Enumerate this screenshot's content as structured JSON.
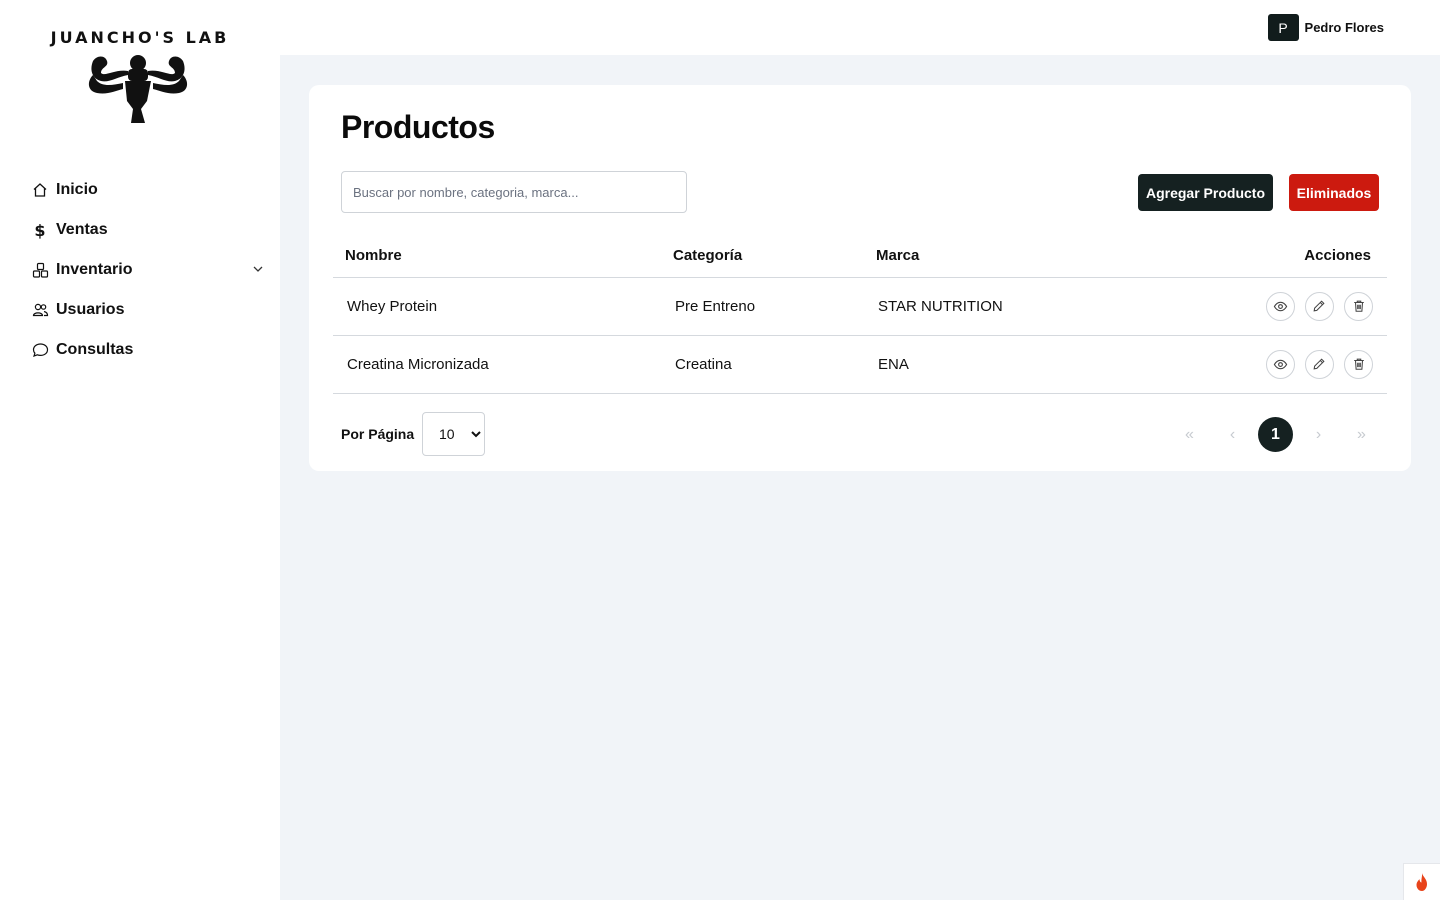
{
  "brand": {
    "name": "JUANCHO'S LAB"
  },
  "sidebar": {
    "items": [
      {
        "label": "Inicio",
        "icon": "home-icon"
      },
      {
        "label": "Ventas",
        "icon": "dollar-icon"
      },
      {
        "label": "Inventario",
        "icon": "boxes-icon",
        "expandable": true
      },
      {
        "label": "Usuarios",
        "icon": "users-icon"
      },
      {
        "label": "Consultas",
        "icon": "chat-icon"
      }
    ]
  },
  "header": {
    "avatar_initial": "P",
    "user_name": "Pedro Flores"
  },
  "main": {
    "title": "Productos",
    "search_placeholder": "Buscar por nombre, categoria, marca...",
    "add_button": "Agregar Producto",
    "deleted_button": "Eliminados",
    "table": {
      "headers": [
        "Nombre",
        "Categoría",
        "Marca",
        "Acciones"
      ],
      "rows": [
        [
          "Whey Protein",
          "Pre Entreno",
          "STAR NUTRITION"
        ],
        [
          "Creatina Micronizada",
          "Creatina",
          "ENA"
        ]
      ]
    },
    "per_page_label": "Por Página",
    "per_page_value": "10",
    "pagination": {
      "first": "«",
      "prev": "‹",
      "current": "1",
      "next": "›",
      "last": "»"
    }
  },
  "colors": {
    "primary": "#152121",
    "danger": "#cc1a0f",
    "background": "#f1f4f8"
  }
}
